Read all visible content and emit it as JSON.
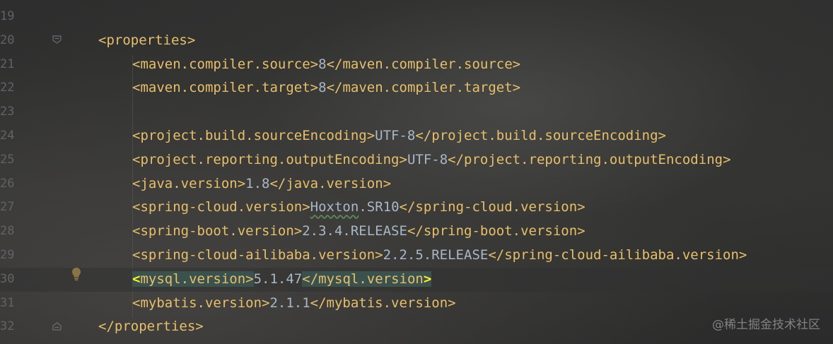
{
  "editor": {
    "line_numbers": [
      "19",
      "20",
      "21",
      "22",
      "23",
      "24",
      "25",
      "26",
      "27",
      "28",
      "29",
      "30",
      "31",
      "32"
    ],
    "active_line": "30",
    "lines": [
      {
        "number": "19",
        "tag_open": "",
        "value": "",
        "tag_close": ""
      },
      {
        "number": "20",
        "tag_open": "<properties>",
        "value": "",
        "tag_close": ""
      },
      {
        "number": "21",
        "tag_open": "<maven.compiler.source>",
        "value": "8",
        "tag_close": "</maven.compiler.source>"
      },
      {
        "number": "22",
        "tag_open": "<maven.compiler.target>",
        "value": "8",
        "tag_close": "</maven.compiler.target>"
      },
      {
        "number": "23",
        "tag_open": "",
        "value": "",
        "tag_close": ""
      },
      {
        "number": "24",
        "tag_open": "<project.build.sourceEncoding>",
        "value": "UTF-8",
        "tag_close": "</project.build.sourceEncoding>"
      },
      {
        "number": "25",
        "tag_open": "<project.reporting.outputEncoding>",
        "value": "UTF-8",
        "tag_close": "</project.reporting.outputEncoding>"
      },
      {
        "number": "26",
        "tag_open": "<java.version>",
        "value": "1.8",
        "tag_close": "</java.version>"
      },
      {
        "number": "27",
        "tag_open": "<spring-cloud.version>",
        "value_a": "Hoxton",
        "value_b": ".SR10",
        "tag_close": "</spring-cloud.version>"
      },
      {
        "number": "28",
        "tag_open": "<spring-boot.version>",
        "value": "2.3.4.RELEASE",
        "tag_close": "</spring-boot.version>"
      },
      {
        "number": "29",
        "tag_open": "<spring-cloud-ailibaba.version>",
        "value": "2.2.5.RELEASE",
        "tag_close": "</spring-cloud-ailibaba.version>"
      },
      {
        "number": "30",
        "tag_open_bracket": "<",
        "tag_open_name": "mysql.version>",
        "value": "5.1.47",
        "tag_close_name": "</mysql.version",
        "tag_close_bracket": ">"
      },
      {
        "number": "31",
        "tag_open": "<mybatis.version>",
        "value": "2.1.1",
        "tag_close": "</mybatis.version>"
      },
      {
        "number": "32",
        "tag_open": "</properties>",
        "value": "",
        "tag_close": ""
      }
    ]
  },
  "icons": {
    "fold_open": "fold-open-icon",
    "fold_close": "fold-close-icon",
    "intention": "lightbulb-icon"
  },
  "colors": {
    "background": "#2b2b2b",
    "tag": "#e8bf6a",
    "text": "#a9b7c6",
    "line_number": "#606366",
    "tag_highlight": "#3b514d",
    "brace_match": "#ffef28",
    "bulb": "#f2c55c"
  },
  "watermark": "@稀土掘金技术社区"
}
